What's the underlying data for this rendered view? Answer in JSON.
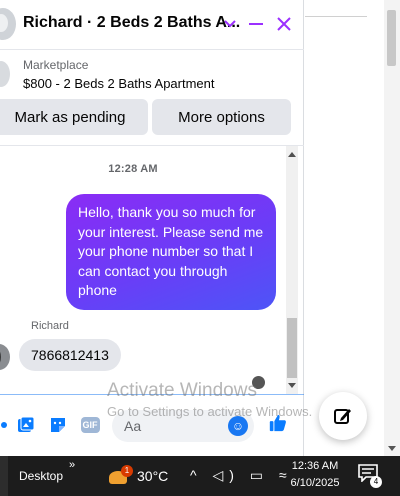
{
  "chat": {
    "title": "Richard · 2 Beds 2 Baths A...",
    "marketplace_label": "Marketplace",
    "listing_title": "$800 - 2 Beds 2 Baths Apartment",
    "buttons": {
      "pending": "Mark as pending",
      "more": "More options"
    },
    "timestamp": "12:28 AM",
    "outgoing_message": "Hello, thank you so much for your interest. Please send me your phone number so that I can contact you through phone",
    "sender_name": "Richard",
    "incoming_message": "7866812413",
    "composer_placeholder": "Aa",
    "accent_color": "#9b30ff"
  },
  "watermark": {
    "line1": "Activate Windows",
    "line2": "Go to Settings to activate Windows."
  },
  "taskbar": {
    "desktop_label": "Desktop",
    "chevron": "»",
    "weather_badge": "1",
    "temperature": "30°C",
    "time": "12:36 AM",
    "date": "6/10/2025",
    "notification_count": "4"
  }
}
